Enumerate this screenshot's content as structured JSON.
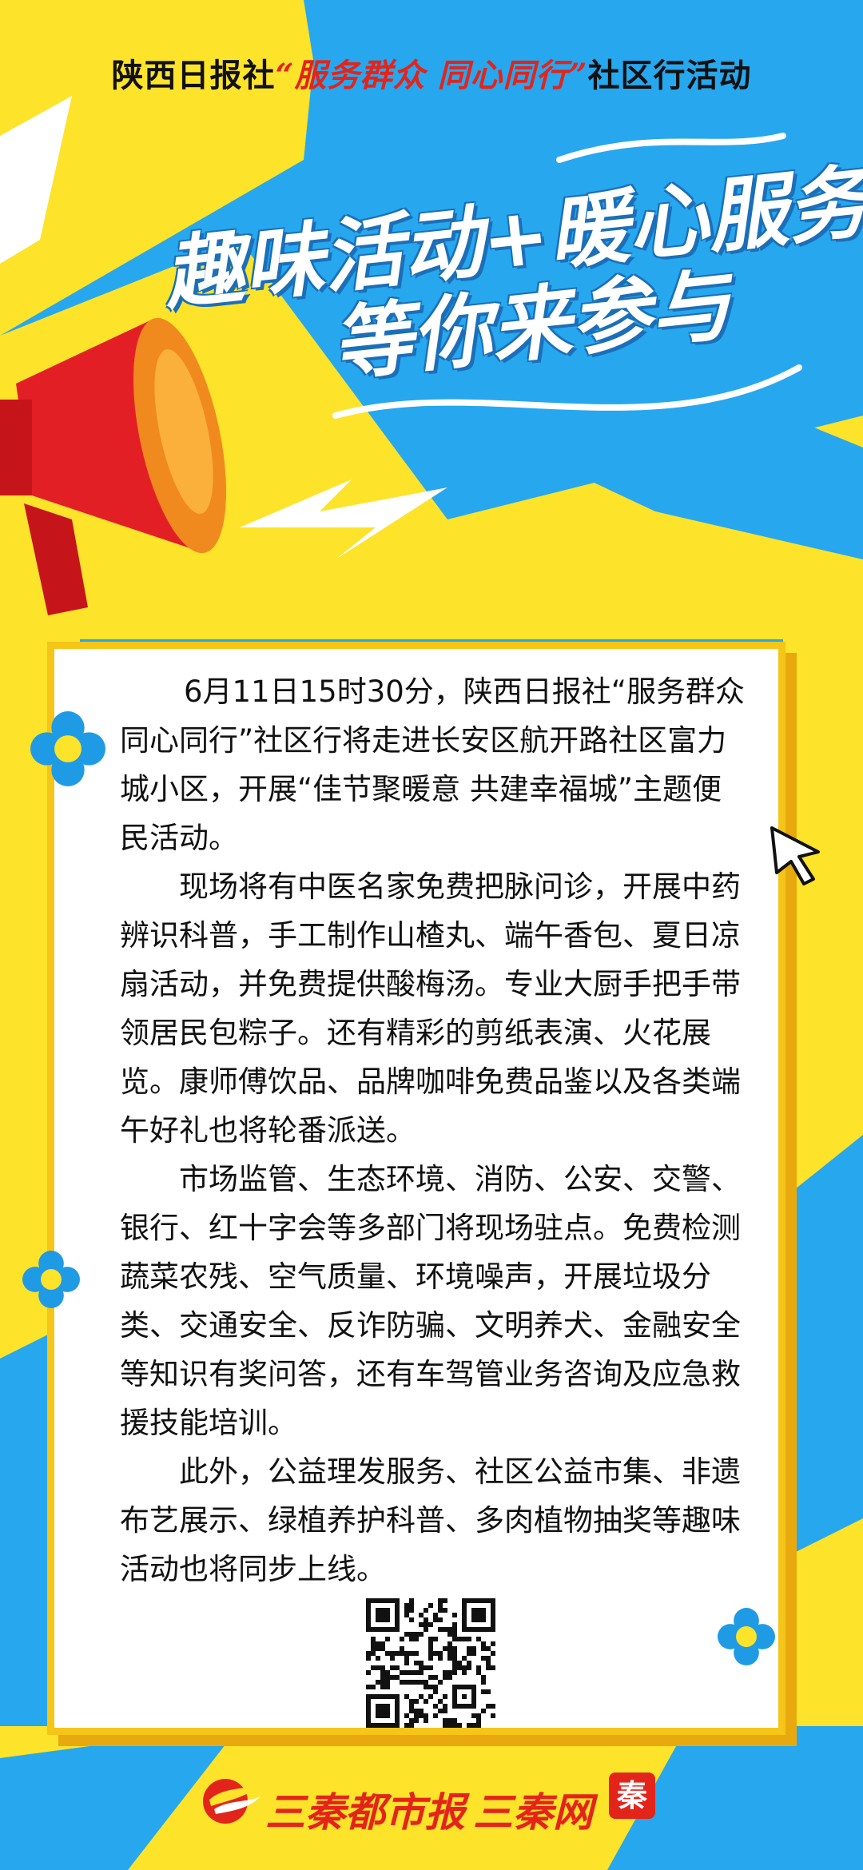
{
  "header": {
    "org": "陕西日报社",
    "slogan": "“服务群众 同心同行”",
    "suffix": "社区行活动"
  },
  "headline": {
    "line1": "趣味活动+暖心服务",
    "line2": "等你来参与"
  },
  "article": {
    "paragraphs": [
      "6月11日15时30分，陕西日报社“服务群众 同心同行”社区行将走进长安区航开路社区富力城小区，开展“佳节聚暖意 共建幸福城”主题便民活动。",
      "现场将有中医名家免费把脉问诊，开展中药辨识科普，手工制作山楂丸、端午香包、夏日凉扇活动，并免费提供酸梅汤。专业大厨手把手带领居民包粽子。还有精彩的剪纸表演、火花展览。康师傅饮品、品牌咖啡免费品鉴以及各类端午好礼也将轮番派送。",
      "市场监管、生态环境、消防、公安、交警、银行、红十字会等多部门将现场驻点。免费检测蔬菜农残、空气质量、环境噪声，开展垃圾分类、交通安全、反诈防骗、文明养犬、金融安全等知识有奖问答，还有车驾管业务咨询及应急救援技能培训。",
      "此外，公益理发服务、社区公益市集、非遗布艺展示、绿植养护科普、多肉植物抽奖等趣味活动也将同步上线。"
    ]
  },
  "footer": {
    "brand1": "三秦都市报",
    "brand2": "三秦网",
    "seal": "秦"
  },
  "colors": {
    "blue": "#27a7ee",
    "yellow": "#fde32a",
    "red": "#e3241b",
    "gold": "#f5c519"
  },
  "icons": [
    "megaphone-icon",
    "cursor-icon",
    "flower-icon",
    "qr-code-icon",
    "logo-icon"
  ]
}
